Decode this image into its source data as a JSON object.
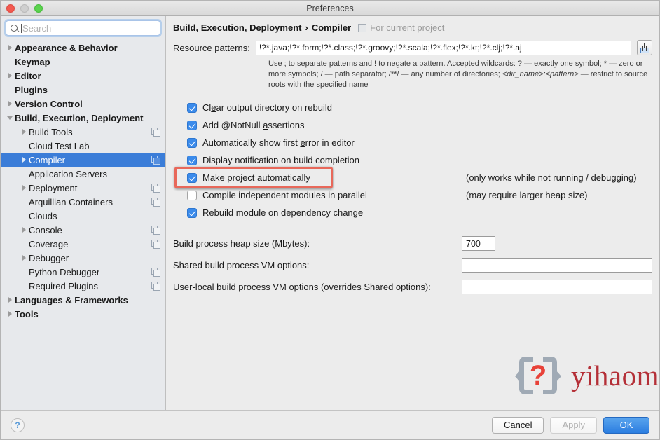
{
  "window": {
    "title": "Preferences",
    "traffic_lights": [
      "close",
      "minimize",
      "maximize"
    ]
  },
  "sidebar": {
    "search": {
      "placeholder": "Search",
      "value": ""
    },
    "items": [
      {
        "label": "Appearance & Behavior",
        "level": 0,
        "bold": true,
        "arrow": "collapsed",
        "selected": false,
        "copy_icon": false
      },
      {
        "label": "Keymap",
        "level": 0,
        "bold": true,
        "arrow": "none",
        "selected": false,
        "copy_icon": false
      },
      {
        "label": "Editor",
        "level": 0,
        "bold": true,
        "arrow": "collapsed",
        "selected": false,
        "copy_icon": false
      },
      {
        "label": "Plugins",
        "level": 0,
        "bold": true,
        "arrow": "none",
        "selected": false,
        "copy_icon": false
      },
      {
        "label": "Version Control",
        "level": 0,
        "bold": true,
        "arrow": "collapsed",
        "selected": false,
        "copy_icon": false
      },
      {
        "label": "Build, Execution, Deployment",
        "level": 0,
        "bold": true,
        "arrow": "expanded",
        "selected": false,
        "copy_icon": false
      },
      {
        "label": "Build Tools",
        "level": 1,
        "bold": false,
        "arrow": "collapsed",
        "selected": false,
        "copy_icon": true
      },
      {
        "label": "Cloud Test Lab",
        "level": 1,
        "bold": false,
        "arrow": "none",
        "selected": false,
        "copy_icon": false
      },
      {
        "label": "Compiler",
        "level": 1,
        "bold": false,
        "arrow": "collapsed",
        "selected": true,
        "copy_icon": true
      },
      {
        "label": "Application Servers",
        "level": 1,
        "bold": false,
        "arrow": "none",
        "selected": false,
        "copy_icon": false
      },
      {
        "label": "Deployment",
        "level": 1,
        "bold": false,
        "arrow": "collapsed",
        "selected": false,
        "copy_icon": true
      },
      {
        "label": "Arquillian Containers",
        "level": 1,
        "bold": false,
        "arrow": "none",
        "selected": false,
        "copy_icon": true
      },
      {
        "label": "Clouds",
        "level": 1,
        "bold": false,
        "arrow": "none",
        "selected": false,
        "copy_icon": false
      },
      {
        "label": "Console",
        "level": 1,
        "bold": false,
        "arrow": "collapsed",
        "selected": false,
        "copy_icon": true
      },
      {
        "label": "Coverage",
        "level": 1,
        "bold": false,
        "arrow": "none",
        "selected": false,
        "copy_icon": true
      },
      {
        "label": "Debugger",
        "level": 1,
        "bold": false,
        "arrow": "collapsed",
        "selected": false,
        "copy_icon": false
      },
      {
        "label": "Python Debugger",
        "level": 1,
        "bold": false,
        "arrow": "none",
        "selected": false,
        "copy_icon": true
      },
      {
        "label": "Required Plugins",
        "level": 1,
        "bold": false,
        "arrow": "none",
        "selected": false,
        "copy_icon": true
      },
      {
        "label": "Languages & Frameworks",
        "level": 0,
        "bold": true,
        "arrow": "collapsed",
        "selected": false,
        "copy_icon": false
      },
      {
        "label": "Tools",
        "level": 0,
        "bold": true,
        "arrow": "collapsed",
        "selected": false,
        "copy_icon": false
      }
    ]
  },
  "main": {
    "breadcrumb": {
      "parent": "Build, Execution, Deployment",
      "separator": "›",
      "current": "Compiler",
      "scope": "For current project"
    },
    "resource_patterns": {
      "label": "Resource patterns:",
      "value": "!?*.java;!?*.form;!?*.class;!?*.groovy;!?*.scala;!?*.flex;!?*.kt;!?*.clj;!?*.aj",
      "button_icon": "import-into-field-icon",
      "hint_line1": "Use ; to separate patterns and ! to negate a pattern. Accepted wildcards: ? — exactly one symbol; * —",
      "hint_line2_a": "zero or more symbols; / — path separator; /**/ — any number of directories; ",
      "hint_line2_italic": "<dir_name>:<pattern>",
      "hint_line3": "— restrict to source roots with the specified name"
    },
    "checkboxes": [
      {
        "label_pre": "Cl",
        "mnemonic": "e",
        "label_post": "ar output directory on rebuild",
        "checked": true,
        "note": "",
        "highlighted": false
      },
      {
        "label_pre": "Add @NotNull ",
        "mnemonic": "a",
        "label_post": "ssertions",
        "checked": true,
        "note": "",
        "highlighted": false
      },
      {
        "label_pre": "Automatically show first ",
        "mnemonic": "e",
        "label_post": "rror in editor",
        "checked": true,
        "note": "",
        "highlighted": false
      },
      {
        "label_pre": "Display notification on build completion",
        "mnemonic": "",
        "label_post": "",
        "checked": true,
        "note": "",
        "highlighted": false
      },
      {
        "label_pre": "Make project automatically",
        "mnemonic": "",
        "label_post": "",
        "checked": true,
        "note": "(only works while not running / debugging)",
        "highlighted": true
      },
      {
        "label_pre": "Compile independent modules in parallel",
        "mnemonic": "",
        "label_post": "",
        "checked": false,
        "note": "(may require larger heap size)",
        "highlighted": false
      },
      {
        "label_pre": "Rebuild module on dependency change",
        "mnemonic": "",
        "label_post": "",
        "checked": true,
        "note": "",
        "highlighted": false
      }
    ],
    "fields": [
      {
        "label": "Build process heap size (Mbytes):",
        "value": "700"
      },
      {
        "label": "Shared build process VM options:",
        "value": ""
      },
      {
        "label": "User-local build process VM options (overrides Shared options):",
        "value": ""
      }
    ],
    "watermark": {
      "mark_char": "?",
      "text": "yihaomen.com"
    }
  },
  "footer": {
    "help": "?",
    "cancel": "Cancel",
    "apply": "Apply",
    "ok": "OK"
  },
  "colors": {
    "selection_blue": "#3b7dd8",
    "primary_button": "#2b7de0",
    "highlight_red": "#e8685a",
    "watermark_red": "#b02028",
    "checkbox_blue": "#3b8beb"
  }
}
